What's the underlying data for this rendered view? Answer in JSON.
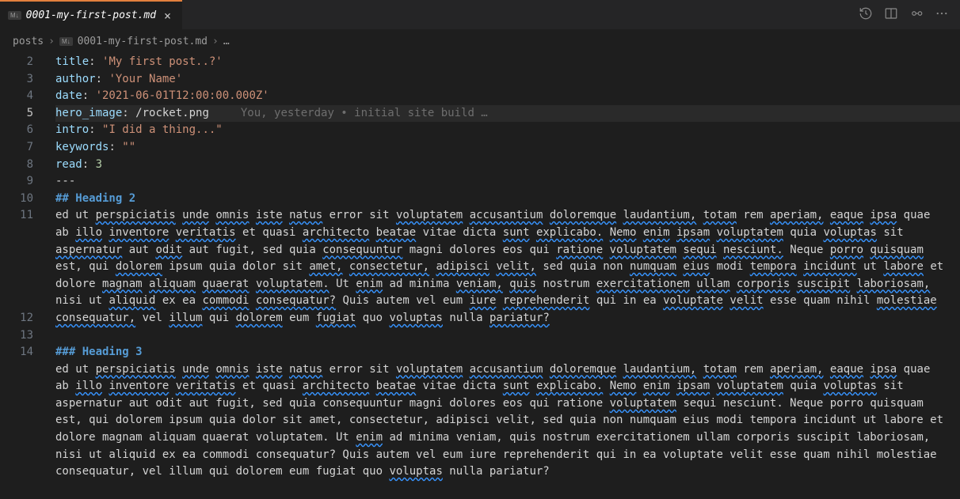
{
  "tab": {
    "badge": "M↓",
    "title": "0001-my-first-post.md"
  },
  "breadcrumbs": {
    "folder": "posts",
    "badge": "M↓",
    "file": "0001-my-first-post.md",
    "tail": "…"
  },
  "frontmatter": {
    "title_key": "title",
    "title_val": "'My first post..?'",
    "author_key": "author",
    "author_val": "'Your Name'",
    "date_key": "date",
    "date_val": "'2021-06-01T12:00:00.000Z'",
    "hero_key": "hero_image",
    "hero_val": "/rocket.png",
    "intro_key": "intro",
    "intro_val": "\"I did a thing...\"",
    "keywords_key": "keywords",
    "keywords_val": "\"\"",
    "read_key": "read",
    "read_val": "3",
    "close": "---"
  },
  "blame": "You, yesterday • initial site build …",
  "headings": {
    "h2_prefix": "## ",
    "h2_text": "Heading 2",
    "h3_prefix": "### ",
    "h3_text": "Heading 3"
  },
  "paragraph_words": [
    "ed",
    "ut",
    "perspiciatis",
    "unde",
    "omnis",
    "iste",
    "natus",
    "error",
    "sit",
    "voluptatem",
    "accusantium",
    "doloremque",
    "laudantium,",
    "totam",
    "rem",
    "aperiam,",
    "eaque",
    "ipsa",
    "quae",
    "ab",
    "illo",
    "inventore",
    "veritatis",
    "et",
    "quasi",
    "architecto",
    "beatae",
    "vitae",
    "dicta",
    "sunt",
    "explicabo.",
    "Nemo",
    "enim",
    "ipsam",
    "voluptatem",
    "quia",
    "voluptas",
    "sit",
    "aspernatur",
    "aut",
    "odit",
    "aut",
    "fugit,",
    "sed",
    "quia",
    "consequuntur",
    "magni",
    "dolores",
    "eos",
    "qui",
    "ratione",
    "voluptatem",
    "sequi",
    "nesciunt.",
    "Neque",
    "porro",
    "quisquam",
    "est,",
    "qui",
    "dolorem",
    "ipsum",
    "quia",
    "dolor",
    "sit",
    "amet,",
    "consectetur,",
    "adipisci",
    "velit,",
    "sed",
    "quia",
    "non",
    "numquam",
    "eius",
    "modi",
    "tempora",
    "incidunt",
    "ut",
    "labore",
    "et",
    "dolore",
    "magnam",
    "aliquam",
    "quaerat",
    "voluptatem.",
    "Ut",
    "enim",
    "ad",
    "minima",
    "veniam,",
    "quis",
    "nostrum",
    "exercitationem",
    "ullam",
    "corporis",
    "suscipit",
    "laboriosam,",
    "nisi",
    "ut",
    "aliquid",
    "ex",
    "ea",
    "commodi",
    "consequatur?",
    "Quis",
    "autem",
    "vel",
    "eum",
    "iure",
    "reprehenderit",
    "qui",
    "in",
    "ea",
    "voluptate",
    "velit",
    "esse",
    "quam",
    "nihil",
    "molestiae",
    "consequatur,",
    "vel",
    "illum",
    "qui",
    "dolorem",
    "eum",
    "fugiat",
    "quo",
    "voluptas",
    "nulla",
    "pariatur?"
  ],
  "paragraph_underlined_h2": [
    "perspiciatis",
    "unde",
    "omnis",
    "iste",
    "natus",
    "voluptatem",
    "accusantium",
    "doloremque",
    "laudantium,",
    "totam",
    "aperiam,",
    "eaque",
    "ipsa",
    "illo",
    "inventore",
    "veritatis",
    "architecto",
    "beatae",
    "sunt",
    "explicabo.",
    "Nemo",
    "enim",
    "ipsam",
    "voluptatem",
    "voluptas",
    "aspernatur",
    "odit",
    "consequuntur",
    "ratione",
    "voluptatem",
    "sequi",
    "nesciunt.",
    "porro",
    "quisquam",
    "dolorem",
    "amet,",
    "consectetur,",
    "adipisci",
    "velit,",
    "numquam",
    "eius",
    "tempora",
    "incidunt",
    "labore",
    "magnam",
    "aliquam",
    "quaerat",
    "voluptatem.",
    "veniam,",
    "quis",
    "exercitationem",
    "ullam",
    "corporis",
    "suscipit",
    "laboriosam,",
    "aliquid",
    "commodi",
    "consequatur?",
    "iure",
    "reprehenderit",
    "voluptate",
    "velit",
    "molestiae",
    "consequatur,",
    "illum",
    "dolorem",
    "fugiat",
    "voluptas",
    "pariatur?"
  ],
  "paragraph_underlined_h3": [
    "perspiciatis",
    "unde",
    "omnis",
    "iste",
    "natus",
    "voluptatem",
    "accusantium",
    "doloremque",
    "laudantium,",
    "totam",
    "aperiam,",
    "eaque",
    "ipsa",
    "illo",
    "inventore",
    "veritatis",
    "architecto",
    "beatae",
    "sunt",
    "explicabo.",
    "Nemo",
    "enim",
    "ipsam",
    "voluptas"
  ],
  "line_numbers": [
    2,
    3,
    4,
    5,
    6,
    7,
    8,
    9,
    10,
    11,
    12,
    13,
    14
  ]
}
